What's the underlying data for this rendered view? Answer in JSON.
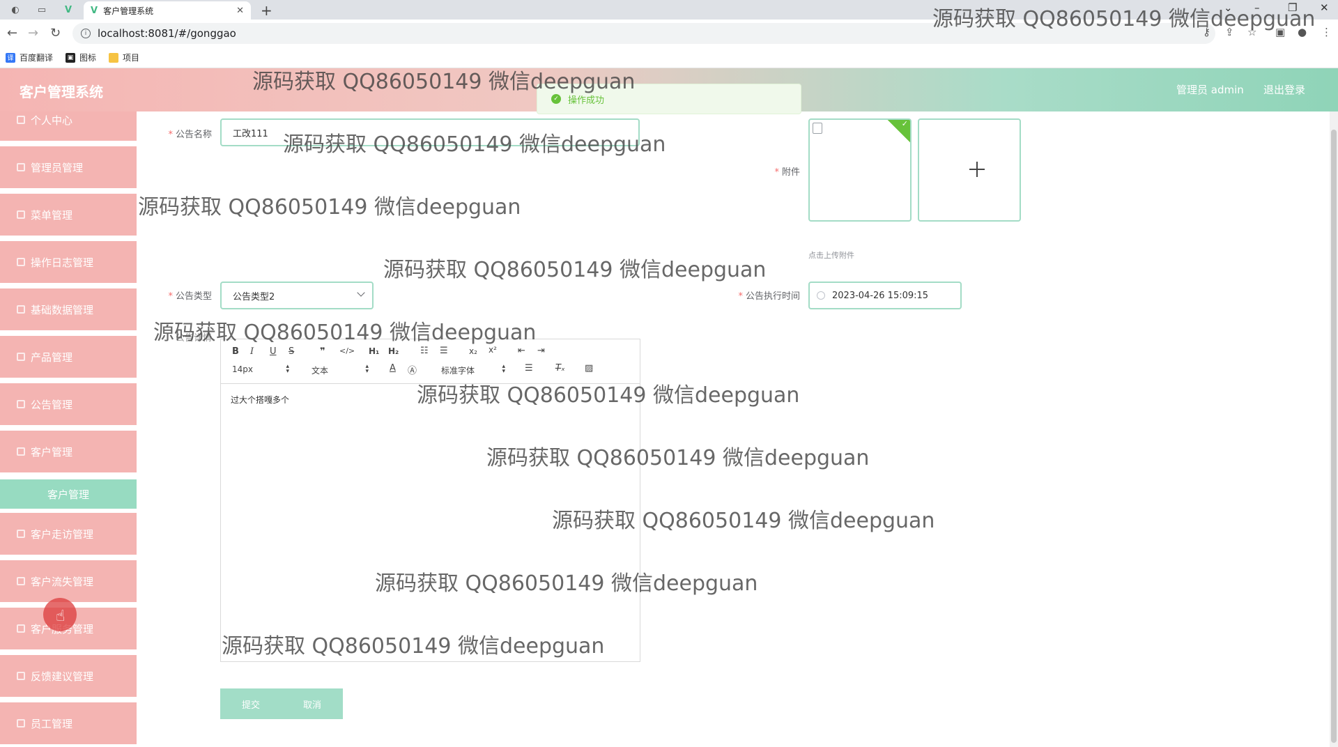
{
  "browser": {
    "tab_title": "客户管理系统",
    "url": "localhost:8081/#/gonggao",
    "bookmarks": [
      "百度翻译",
      "图标",
      "项目"
    ]
  },
  "header": {
    "app_title": "客户管理系统",
    "admin_label": "管理员 admin",
    "logout_label": "退出登录",
    "toast": "操作成功"
  },
  "sidebar": {
    "items": [
      {
        "label": "个人中心"
      },
      {
        "label": "管理员管理"
      },
      {
        "label": "菜单管理"
      },
      {
        "label": "操作日志管理"
      },
      {
        "label": "基础数据管理"
      },
      {
        "label": "产品管理"
      },
      {
        "label": "公告管理"
      },
      {
        "label": "客户管理"
      },
      {
        "label": "客户管理"
      },
      {
        "label": "客户走访管理"
      },
      {
        "label": "客户流失管理"
      },
      {
        "label": "客户服务管理"
      },
      {
        "label": "反馈建议管理"
      },
      {
        "label": "员工管理"
      }
    ]
  },
  "form": {
    "title_label": "公告名称",
    "title_value": "工改111",
    "attachment_label": "附件",
    "upload_tip": "点击上传附件",
    "type_label": "公告类型",
    "type_value": "公告类型2",
    "time_label": "公告执行时间",
    "time_value": "2023-04-26 15:09:15",
    "detail_label": "公告详情",
    "editor": {
      "font_size": "14px",
      "paragraph": "文本",
      "font_family": "标准字体",
      "content": "过大个搭嘎多个"
    },
    "submit_label": "提交",
    "cancel_label": "取消"
  },
  "watermark": "源码获取 QQ86050149 微信deepguan",
  "colors": {
    "sidebar_item": "#f4b4b2",
    "sidebar_active": "#97dbc1",
    "input_border": "#a3dcc6",
    "button": "#a2ddc7",
    "success": "#67c23a"
  }
}
